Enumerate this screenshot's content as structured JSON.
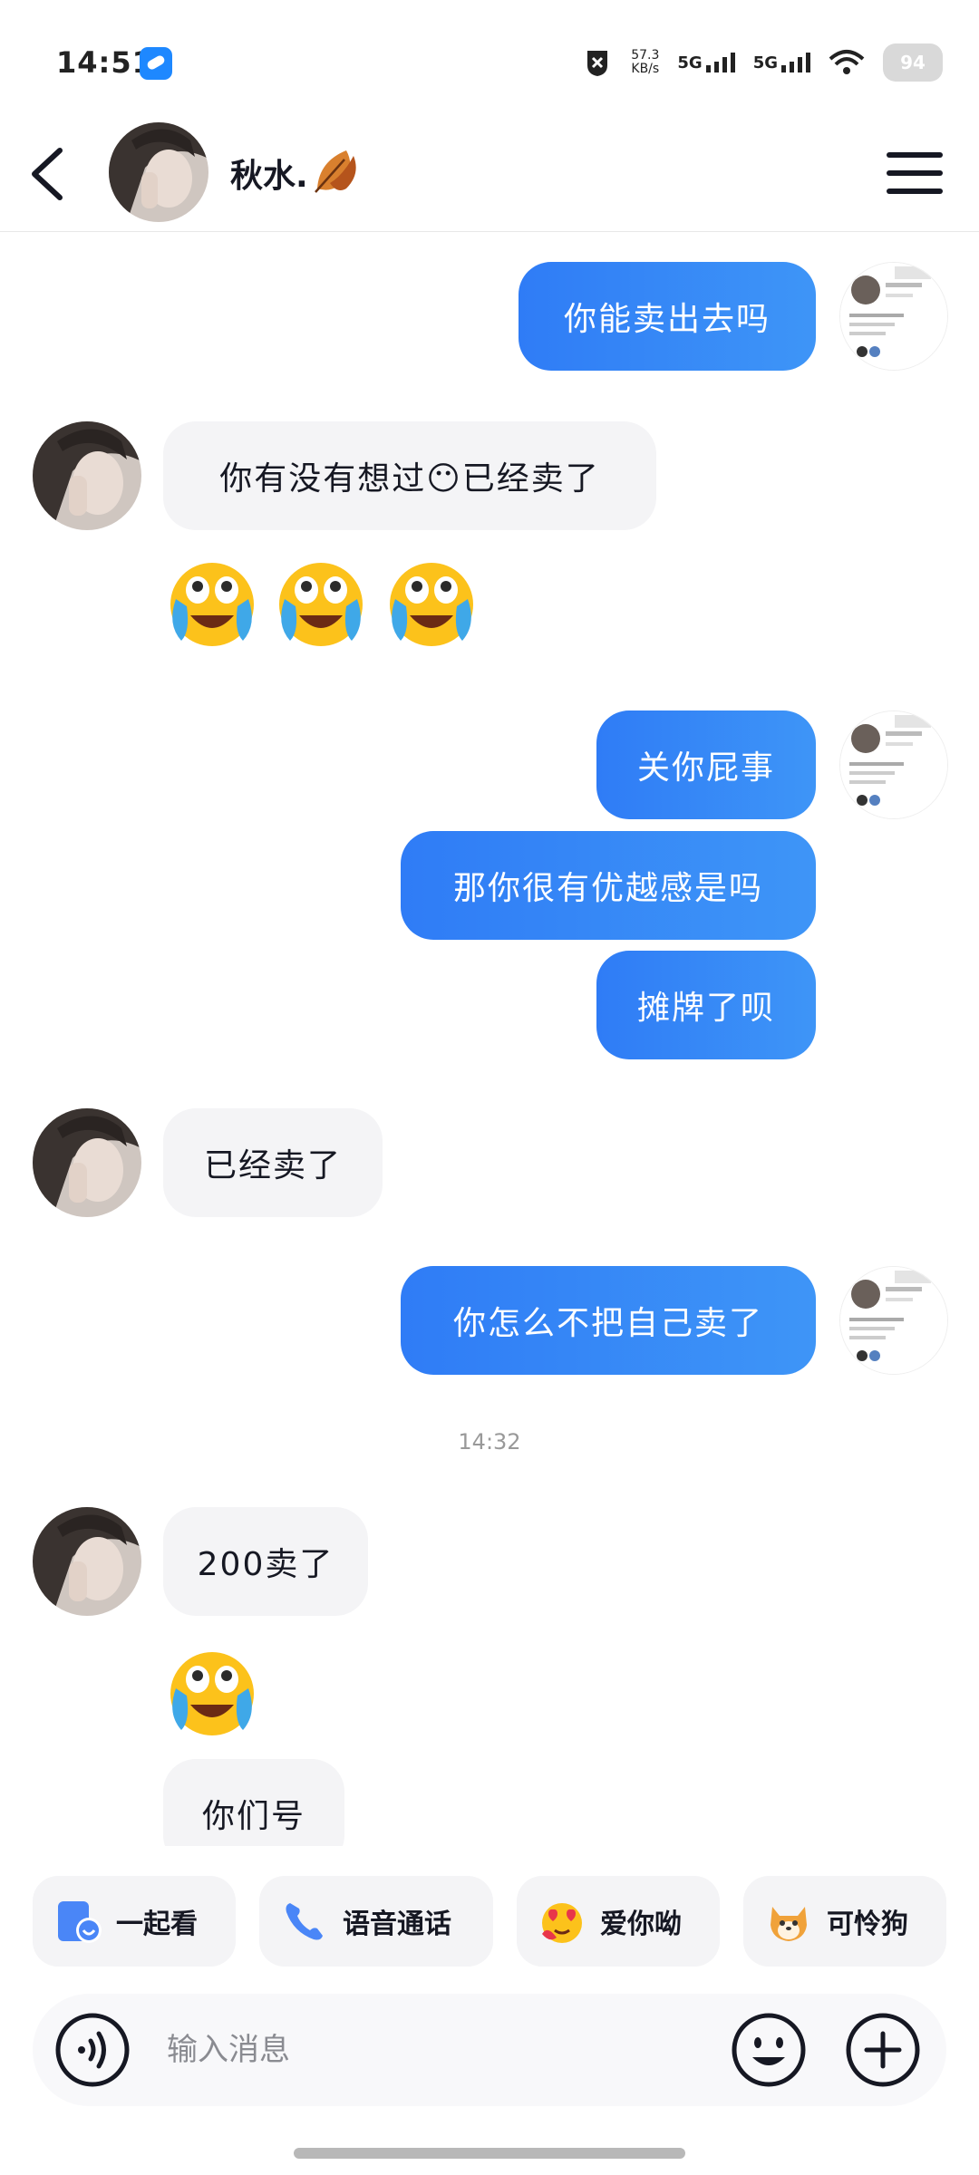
{
  "status_bar": {
    "time": "14:51",
    "net_speed_value": "57.3",
    "net_speed_unit": "KB/s",
    "sim1": "5G",
    "sim2": "5G",
    "battery": "94"
  },
  "header": {
    "contact_name": "秋水."
  },
  "messages": [
    {
      "from": "me",
      "text": "你能卖出去吗"
    },
    {
      "from": "other",
      "text": "你有没有想过😶已经卖了"
    },
    {
      "from": "other",
      "emoji": "crying-laughing",
      "count": 3
    },
    {
      "from": "me",
      "text": "关你屁事"
    },
    {
      "from": "me",
      "text": "那你很有优越感是吗"
    },
    {
      "from": "me",
      "text": "摊牌了呗"
    },
    {
      "from": "other",
      "text": "已经卖了"
    },
    {
      "from": "me",
      "text": "你怎么不把自己卖了"
    },
    {
      "type": "time",
      "text": "14:32"
    },
    {
      "from": "other",
      "text": "200卖了"
    },
    {
      "from": "other",
      "emoji": "crying-laughing",
      "count": 1
    },
    {
      "from": "other",
      "text": "你们号"
    }
  ],
  "quick_actions": [
    {
      "label": "一起看",
      "icon": "watch-together-icon"
    },
    {
      "label": "语音通话",
      "icon": "phone-icon"
    },
    {
      "label": "爱你呦",
      "icon": "love-emoji-icon"
    },
    {
      "label": "可怜狗",
      "icon": "shiba-dog-icon"
    }
  ],
  "input": {
    "placeholder": "输入消息"
  },
  "colors": {
    "sent_bubble": "#3a8ef6",
    "received_bubble": "#f4f4f6",
    "accent": "#2f7cf6"
  }
}
